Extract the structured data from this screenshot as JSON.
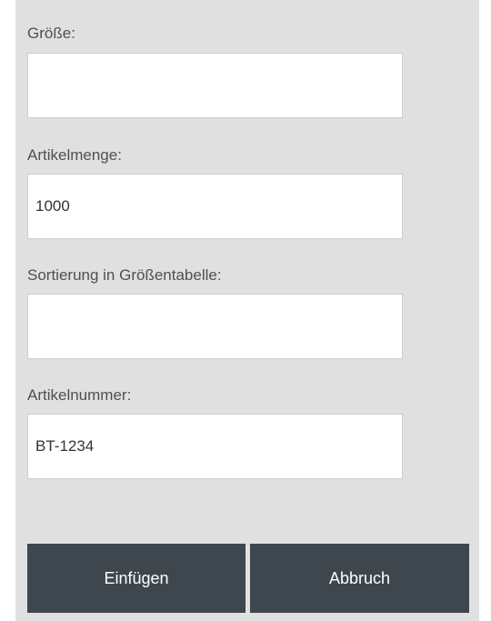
{
  "form": {
    "fields": [
      {
        "label": "Größe:",
        "value": "",
        "placeholder": ""
      },
      {
        "label": "Artikelmenge:",
        "value": "1000",
        "placeholder": ""
      },
      {
        "label": "Sortierung in Größentabelle:",
        "value": "",
        "placeholder": ""
      },
      {
        "label": "Artikelnummer:",
        "value": "BT-1234",
        "placeholder": ""
      }
    ],
    "buttons": {
      "insert_label": "Einfügen",
      "cancel_label": "Abbruch"
    }
  },
  "colors": {
    "panel_background": "#e0e0e0",
    "button_background": "#3e464e",
    "button_text": "#ffffff",
    "label_text": "#505050"
  }
}
